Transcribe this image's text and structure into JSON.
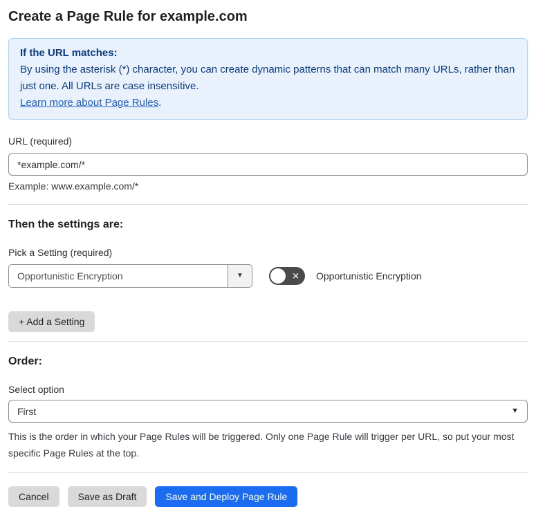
{
  "page": {
    "title": "Create a Page Rule for example.com"
  },
  "info_box": {
    "heading": "If the URL matches:",
    "body": "By using the asterisk (*) character, you can create dynamic patterns that can match many URLs, rather than just one. All URLs are case insensitive.",
    "link_label": "Learn more about Page Rules",
    "link_suffix": "."
  },
  "url_field": {
    "label": "URL (required)",
    "value": "*example.com/*",
    "example": "Example: www.example.com/*"
  },
  "settings_section": {
    "heading": "Then the settings are:",
    "picker_label": "Pick a Setting (required)",
    "picker_value": "Opportunistic Encryption",
    "toggle_state": "off",
    "toggle_icon": "✕",
    "toggle_label": "Opportunistic Encryption",
    "add_button_label": "+ Add a Setting"
  },
  "order_section": {
    "heading": "Order:",
    "select_label": "Select option",
    "select_value": "First",
    "help_text": "This is the order in which your Page Rules will be triggered. Only one Page Rule will trigger per URL, so put your most specific Page Rules at the top."
  },
  "footer": {
    "cancel_label": "Cancel",
    "save_draft_label": "Save as Draft",
    "save_deploy_label": "Save and Deploy Page Rule"
  },
  "icons": {
    "dropdown_caret": "▼"
  },
  "colors": {
    "primary_blue": "#1b6cf0",
    "info_background": "#e9f2fc",
    "info_border": "#a9cdf1",
    "info_text": "#0b3a81",
    "link_blue": "#1e5fc2",
    "button_gray": "#d9d9d9",
    "toggle_off_gray": "#4a4a4a"
  }
}
